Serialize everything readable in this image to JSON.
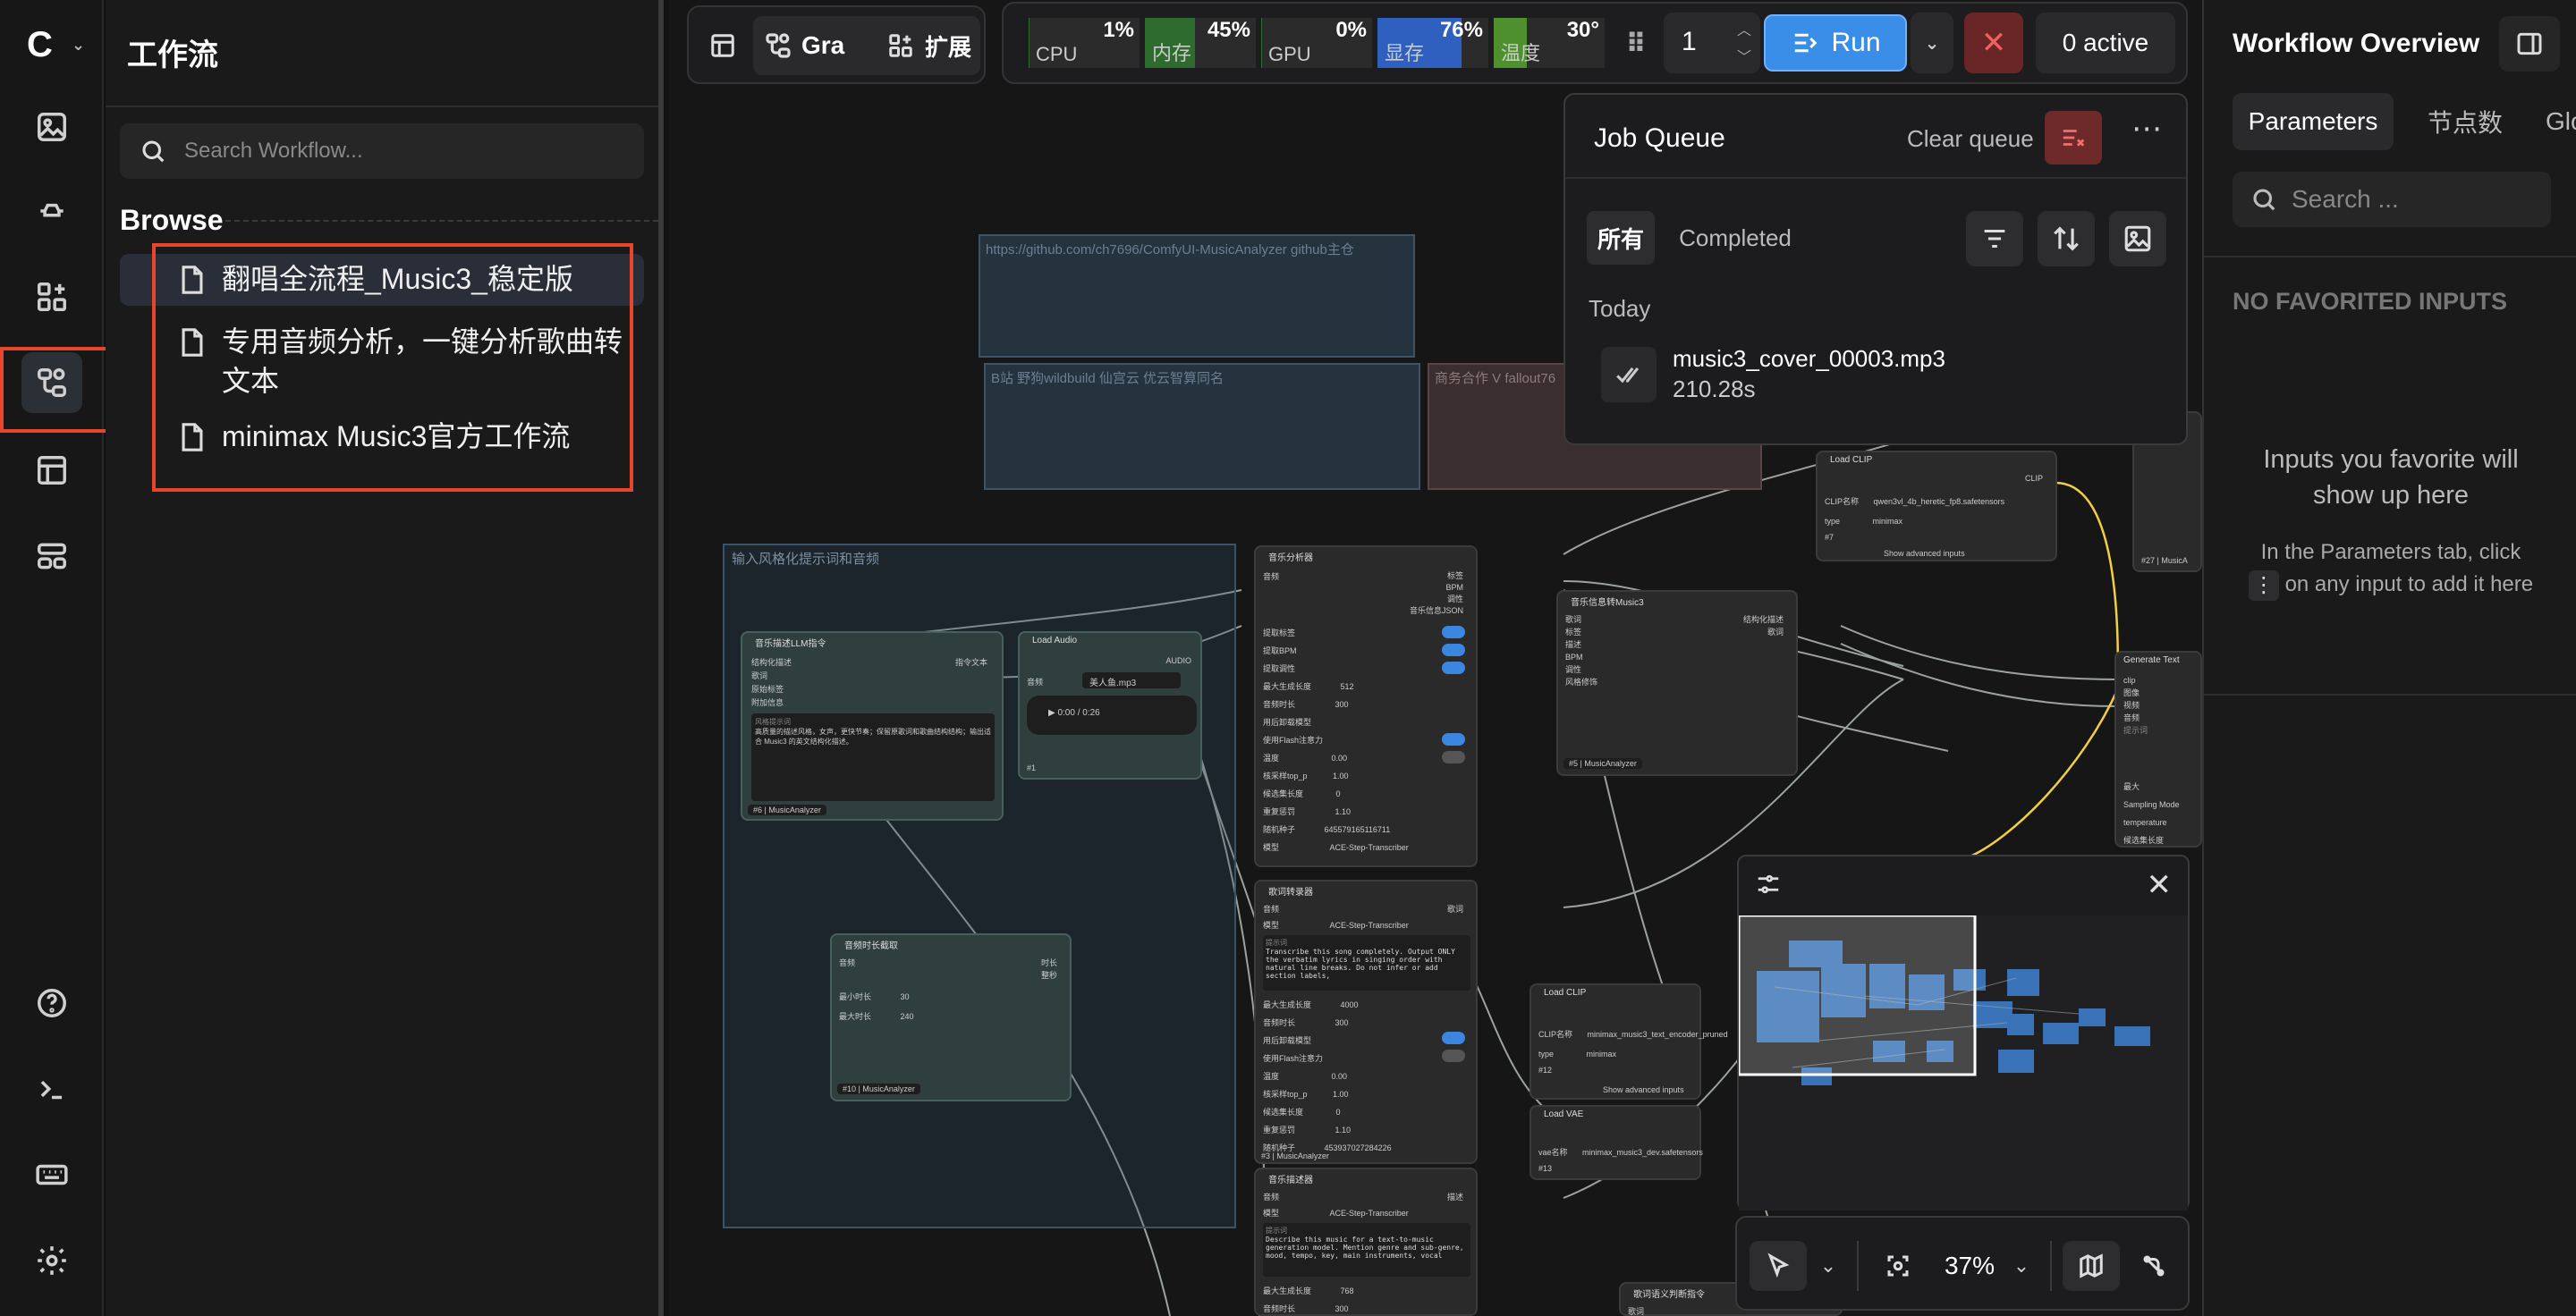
{
  "rail": {
    "logo": "C",
    "items": [
      {
        "name": "images-icon"
      },
      {
        "name": "models-icon"
      },
      {
        "name": "nodes-icon"
      },
      {
        "name": "workflows-icon"
      },
      {
        "name": "templates-icon"
      },
      {
        "name": "layout-icon"
      }
    ],
    "bottom": [
      {
        "name": "help-icon"
      },
      {
        "name": "terminal-icon"
      },
      {
        "name": "keyboard-icon"
      },
      {
        "name": "settings-icon"
      }
    ]
  },
  "sidebar": {
    "title": "工作流",
    "search_placeholder": "Search Workflow...",
    "browse_label": "Browse",
    "workflows": [
      {
        "label": "翻唱全流程_Music3_稳定版",
        "selected": true
      },
      {
        "label": "专用音频分析，一键分析歌曲转文本",
        "selected": false
      },
      {
        "label": "minimax Music3官方工作流",
        "selected": false
      }
    ]
  },
  "toolbar": {
    "graph_label": "Gra",
    "extensions_label": "扩展",
    "stats": [
      {
        "label": "CPU",
        "value": "1%",
        "pct": 1,
        "color": "#2e6b2e"
      },
      {
        "label": "内存",
        "value": "45%",
        "pct": 45,
        "color": "#2e6b2e"
      },
      {
        "label": "GPU",
        "value": "0%",
        "pct": 0,
        "color": "#2e6b2e"
      },
      {
        "label": "显存",
        "value": "76%",
        "pct": 76,
        "color": "#2f5fbf"
      },
      {
        "label": "温度",
        "value": "30°",
        "pct": 30,
        "color": "#4e8f2e"
      }
    ],
    "batch_count": "1",
    "run_label": "Run",
    "active_label": "0 active"
  },
  "job_queue": {
    "title": "Job Queue",
    "clear_label": "Clear queue",
    "tabs": [
      {
        "label": "所有",
        "active": true
      },
      {
        "label": "Completed",
        "active": false
      }
    ],
    "section": "Today",
    "jobs": [
      {
        "name": "music3_cover_00003.mp3",
        "duration": "210.28s"
      }
    ]
  },
  "right_panel": {
    "title": "Workflow Overview",
    "tabs": [
      {
        "label": "Parameters",
        "active": true
      },
      {
        "label": "节点数",
        "active": false
      },
      {
        "label": "Glo",
        "active": false
      }
    ],
    "search_placeholder": "Search ...",
    "no_favorites": "NO FAVORITED INPUTS",
    "hint_line1": "Inputs you favorite will",
    "hint_line2": "show up here",
    "hint_small1": "In the Parameters tab, click",
    "hint_small2": "on any input to add it here"
  },
  "canvas": {
    "notes": [
      {
        "text": "https://github.com/ch7696/ComfyUI-MusicAnalyzer  github主仓"
      },
      {
        "text": "B站 野狗wildbuild 仙宫云 优云智算同名"
      },
      {
        "text": "商务合作 V fallout76"
      }
    ],
    "group_title": "输入风格化提示词和音频",
    "nodes": {
      "llm": {
        "title": "音乐描述LLM指令",
        "out": "指令文本",
        "inputs": [
          "结构化描述",
          "歌词",
          "原始标签",
          "附加信息"
        ],
        "prompt_label": "风格提示词",
        "prompt": "高质量的描述风格，女声，更快节奏；保留原歌词和歌曲结构结构；输出适合 Music3 的英文结构化描述。",
        "id": "#6",
        "tag": "MusicAnalyzer"
      },
      "load_audio": {
        "title": "Load Audio",
        "out": "AUDIO",
        "file_label": "音频",
        "file": "美人鱼.mp3",
        "time": "0:00 / 0:26",
        "id": "#1"
      },
      "analyzer": {
        "title": "音乐分析器",
        "in": "音频",
        "outs": [
          "标签",
          "BPM",
          "调性",
          "音乐信息JSON"
        ],
        "rows": [
          "提取标签",
          "提取BPM",
          "提取调性"
        ],
        "max_tokens_label": "最大生成长度",
        "max_tokens": "512",
        "duration_label": "音频时长",
        "duration": "300",
        "flash_label": "用后卸载模型",
        "attn_label": "使用Flash注意力",
        "temp_label": "温度",
        "temp": "0.00",
        "topp_label": "核采样top_p",
        "topp": "1.00",
        "beam_label": "候选集长度",
        "beam": "0",
        "rep_label": "重复惩罚",
        "rep": "1.10",
        "seed_label": "随机种子",
        "seed": "645579165116711",
        "model_label": "模型",
        "model": "ACE-Step-Transcriber"
      },
      "transcriber": {
        "title": "歌词转录器",
        "in": "音频",
        "out": "歌词",
        "model_label": "模型",
        "model": "ACE-Step-Transcriber",
        "prompt_label": "提示词",
        "prompt": "Transcribe this song completely. Output ONLY the verbatim lyrics in singing order with natural line breaks. Do not infer or add section labels,",
        "max_tokens_label": "最大生成长度",
        "max_tokens": "4000",
        "duration_label": "音频时长",
        "duration": "300",
        "unload_label": "用后卸载模型",
        "attn_label": "使用Flash注意力",
        "temp_label": "温度",
        "temp": "0.00",
        "topp_label": "核采样top_p",
        "topp": "1.00",
        "beam_label": "候选集长度",
        "beam": "0",
        "rep_label": "重复惩罚",
        "rep": "1.10",
        "seed_label": "随机种子",
        "seed": "453937027284226",
        "id": "#3",
        "tag": "MusicAnalyzer"
      },
      "desc": {
        "title": "音乐描述器",
        "in": "音频",
        "out": "描述",
        "model_label": "模型",
        "model": "ACE-Step-Transcriber",
        "prompt_label": "提示词",
        "prompt": "Describe this music for a text-to-music generation model. Mention genre and sub-genre, mood, tempo, key, main instruments, vocal",
        "max_tokens_label": "最大生成长度",
        "max_tokens": "768",
        "duration_label": "音频时长",
        "duration": "300"
      },
      "duration": {
        "title": "音频时长截取",
        "in": "音频",
        "outs": [
          "时长",
          "整秒"
        ],
        "min_label": "最小时长",
        "min": "30",
        "max_label": "最大时长",
        "max": "240",
        "id": "#10",
        "tag": "MusicAnalyzer"
      },
      "info": {
        "title": "音乐信息转Music3",
        "inputs": [
          "歌词",
          "标签",
          "描述",
          "BPM",
          "调性",
          "风格修饰"
        ],
        "outs": [
          "结构化描述",
          "歌词"
        ],
        "id": "#5",
        "tag": "MusicAnalyzer"
      },
      "load_clip_top": {
        "title": "Load CLIP",
        "out": "CLIP",
        "name_label": "CLIP名称",
        "name": "qwen3vl_4b_heretic_fp8.safetensors",
        "type_label": "type",
        "type": "minimax",
        "id": "#7",
        "adv": "Show advanced inputs"
      },
      "load_clip_bottom": {
        "title": "Load CLIP",
        "name_label": "CLIP名称",
        "name": "minimax_music3_text_encoder_pruned",
        "type_label": "type",
        "type": "minimax",
        "id": "#12",
        "adv": "Show advanced inputs"
      },
      "load_vae": {
        "title": "Load VAE",
        "name_label": "vae名称",
        "name": "minimax_music3_dev.safetensors",
        "id": "#13"
      },
      "gen_text": {
        "title": "Generate Text",
        "inputs": [
          "clip",
          "图像",
          "视频",
          "音频"
        ],
        "prompt_label": "提示词",
        "rows": [
          "最大",
          "Sampling Mode",
          "temperature",
          "候选集长度"
        ]
      },
      "lyric_llm": {
        "title": "歌词语义判断指令",
        "in": "歌词"
      },
      "misc_id": "#27",
      "misc_tag": "MusicA"
    }
  },
  "zoom": {
    "value": "37%"
  }
}
